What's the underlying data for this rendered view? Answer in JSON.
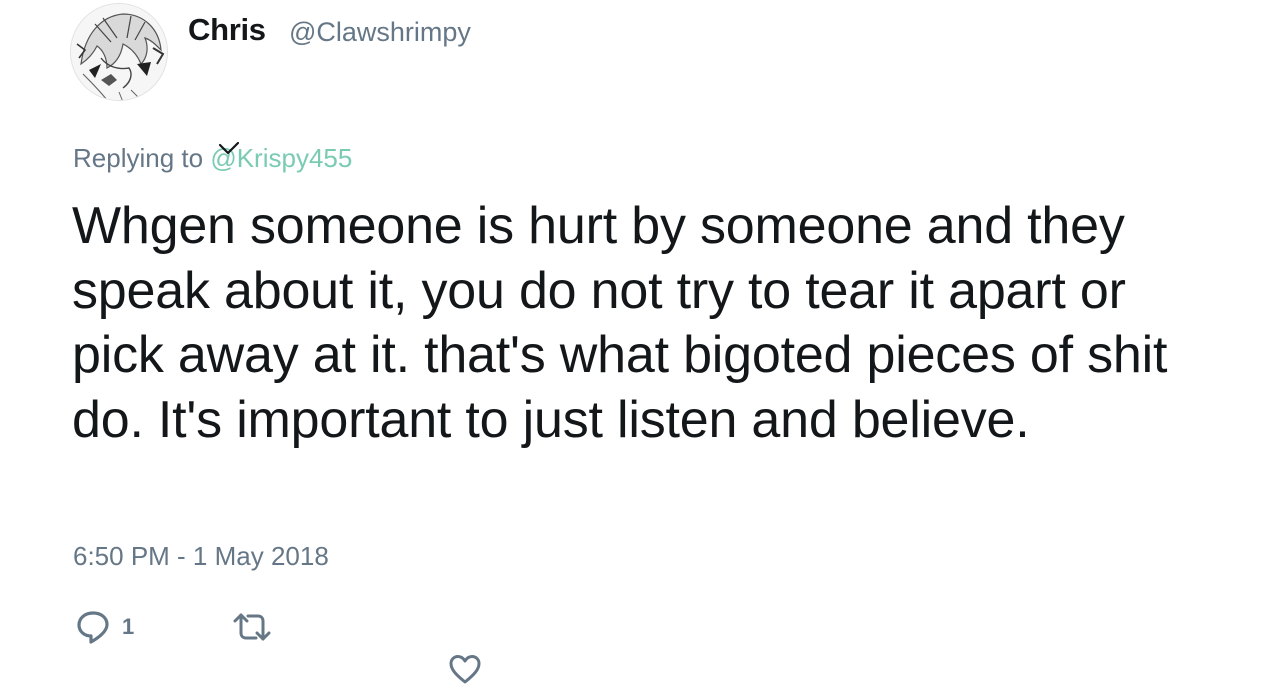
{
  "author": {
    "display_name": "Chris",
    "handle": "@Clawshrimpy",
    "avatar_icon": "anime-avatar-icon"
  },
  "reply": {
    "prefix": "Replying to",
    "target": "@Krispy455",
    "target_color": "#79cbb2"
  },
  "tweet": {
    "text": "Whgen someone is hurt by someone and they speak about it, you do not try to tear it apart or pick away at it. that's what bigoted pieces of shit do. It's important to just listen and believe.",
    "timestamp": "6:50 PM - 1 May 2018"
  },
  "actions": {
    "reply_icon": "reply-bubble-icon",
    "reply_count": "1",
    "retweet_icon": "retweet-icon",
    "like_icon": "heart-icon"
  },
  "colors": {
    "text": "#14171a",
    "muted": "#657786",
    "link": "#79cbb2"
  }
}
